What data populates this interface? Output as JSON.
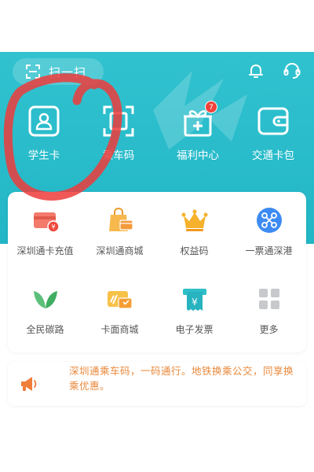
{
  "header": {
    "scan_label": "扫一扫"
  },
  "quick_actions": [
    {
      "label": "学生卡",
      "icon": "student-card-icon"
    },
    {
      "label": "乘车码",
      "icon": "ride-code-icon"
    },
    {
      "label": "福利中心",
      "icon": "gift-icon",
      "badge": "7"
    },
    {
      "label": "交通卡包",
      "icon": "card-wallet-icon"
    }
  ],
  "services": [
    {
      "label": "深圳通卡充值",
      "icon": "card-recharge-icon"
    },
    {
      "label": "深圳通商城",
      "icon": "shopping-bag-icon"
    },
    {
      "label": "权益码",
      "icon": "crown-icon"
    },
    {
      "label": "一票通深港",
      "icon": "network-icon"
    },
    {
      "label": "全民碳路",
      "icon": "leaf-icon"
    },
    {
      "label": "卡面商城",
      "icon": "card-face-icon"
    },
    {
      "label": "电子发票",
      "icon": "invoice-icon"
    },
    {
      "label": "更多",
      "icon": "more-grid-icon"
    }
  ],
  "notice": {
    "text": "深圳通乘车码，一码通行。地铁换乘公交，同享换乘优惠。",
    "icon": "megaphone-icon"
  },
  "colors": {
    "header": "#22b6c6",
    "notice_text": "#e9883a",
    "badge": "#f0413a",
    "annotation": "#ee3b3b"
  }
}
